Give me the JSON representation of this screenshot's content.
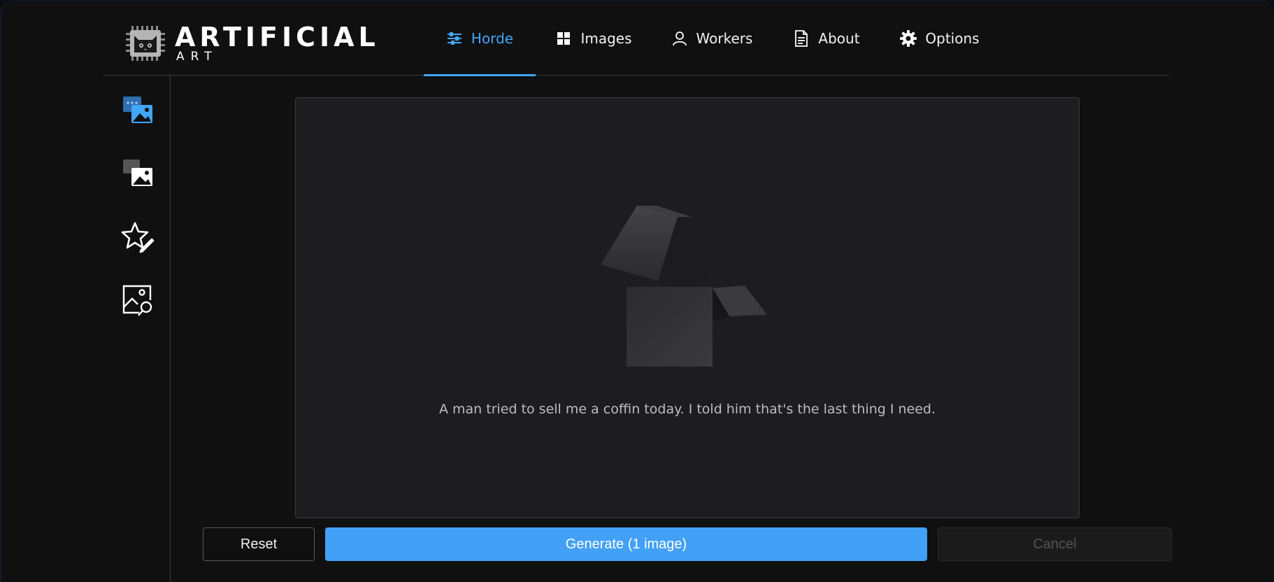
{
  "logo": {
    "title": "ARTIFICIAL",
    "subtitle": "ART"
  },
  "nav": {
    "items": [
      {
        "label": "Horde",
        "icon": "sliders-icon",
        "active": true
      },
      {
        "label": "Images",
        "icon": "grid-icon"
      },
      {
        "label": "Workers",
        "icon": "user-icon"
      },
      {
        "label": "About",
        "icon": "document-icon"
      },
      {
        "label": "Options",
        "icon": "gear-icon"
      }
    ]
  },
  "sidebar": {
    "items": [
      {
        "name": "text-to-image",
        "icon": "text-image-icon",
        "active": true
      },
      {
        "name": "image-to-image",
        "icon": "image-image-icon"
      },
      {
        "name": "rate-images",
        "icon": "star-edit-icon"
      },
      {
        "name": "interrogate",
        "icon": "image-search-icon"
      }
    ]
  },
  "main": {
    "placeholder_text": "A man tried to sell me a coffin today. I told him that's the last thing I need."
  },
  "actions": {
    "reset_label": "Reset",
    "generate_label": "Generate (1 image)",
    "cancel_label": "Cancel"
  },
  "colors": {
    "accent": "#42a5f5",
    "background": "#101010",
    "panel": "#1d1d1f"
  }
}
